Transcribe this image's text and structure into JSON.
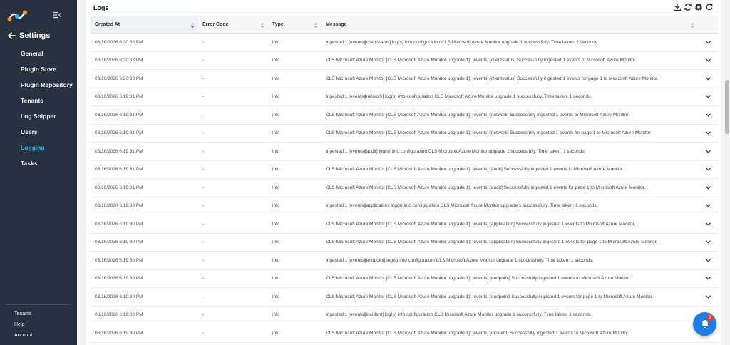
{
  "sidebar": {
    "settings_title": "Settings",
    "active_color": "#2bb6e9",
    "items": [
      {
        "label": "General"
      },
      {
        "label": "Plugin Store"
      },
      {
        "label": "Plugin Repository"
      },
      {
        "label": "Tenants"
      },
      {
        "label": "Log Shipper"
      },
      {
        "label": "Users"
      },
      {
        "label": "Logging",
        "active": true
      },
      {
        "label": "Tasks"
      }
    ],
    "bottom_links": [
      {
        "label": "Tenants"
      },
      {
        "label": "Help"
      },
      {
        "label": "Account"
      }
    ]
  },
  "panel": {
    "title": "Logs",
    "tool_icons": [
      "download-icon",
      "sync-icon",
      "settings-icon",
      "refresh-icon"
    ]
  },
  "table": {
    "columns": [
      {
        "label": "Created At",
        "sorted": true
      },
      {
        "label": "Error Code"
      },
      {
        "label": "Type"
      },
      {
        "label": "Message"
      }
    ],
    "rows": [
      {
        "created_at": "03/16/2026 6:20:33 PM",
        "error_code": "-",
        "type": "info",
        "message": "Ingested 1 [events][clientstatus] log(s) into configuration CLS Microsoft Azure Monitor upgrade 1 successfully. Time taken: 2 seconds."
      },
      {
        "created_at": "03/16/2026 6:20:33 PM",
        "error_code": "-",
        "type": "info",
        "message": "CLS Microsoft Azure Monitor [CLS Microsoft Azure Monitor upgrade 1]: [events]:[clientstatus] Successfully ingested 1 events to Microsoft Azure Monitor."
      },
      {
        "created_at": "03/16/2026 6:20:33 PM",
        "error_code": "-",
        "type": "info",
        "message": "CLS Microsoft Azure Monitor [CLS Microsoft Azure Monitor upgrade 1]: [events]:[clientstatus] Successfully ingested 1 events for page 1 to Microsoft Azure Monitor."
      },
      {
        "created_at": "03/16/2026 6:19:31 PM",
        "error_code": "-",
        "type": "info",
        "message": "Ingested 1 [events][network] log(s) into configuration CLS Microsoft Azure Monitor upgrade 1 successfully. Time taken: 1 seconds."
      },
      {
        "created_at": "03/16/2026 6:19:31 PM",
        "error_code": "-",
        "type": "info",
        "message": "CLS Microsoft Azure Monitor [CLS Microsoft Azure Monitor upgrade 1]: [events]:[network] Successfully ingested 1 events to Microsoft Azure Monitor."
      },
      {
        "created_at": "03/16/2026 6:19:31 PM",
        "error_code": "-",
        "type": "info",
        "message": "CLS Microsoft Azure Monitor [CLS Microsoft Azure Monitor upgrade 1]: [events]:[network] Successfully ingested 1 events for page 1 to Microsoft Azure Monitor."
      },
      {
        "created_at": "03/16/2026 6:19:31 PM",
        "error_code": "-",
        "type": "info",
        "message": "Ingested 1 [events][audit] log(s) into configuration CLS Microsoft Azure Monitor upgrade 1 successfully. Time taken: 1 seconds."
      },
      {
        "created_at": "03/16/2026 6:19:31 PM",
        "error_code": "-",
        "type": "info",
        "message": "CLS Microsoft Azure Monitor [CLS Microsoft Azure Monitor upgrade 1]: [events]:[audit] Successfully ingested 1 events to Microsoft Azure Monitor."
      },
      {
        "created_at": "03/16/2026 6:19:31 PM",
        "error_code": "-",
        "type": "info",
        "message": "CLS Microsoft Azure Monitor [CLS Microsoft Azure Monitor upgrade 1]: [events]:[audit] Successfully ingested 1 events for page 1 to Microsoft Azure Monitor."
      },
      {
        "created_at": "03/16/2026 6:19:30 PM",
        "error_code": "-",
        "type": "info",
        "message": "Ingested 1 [events][application] log(s) into configuration CLS Microsoft Azure Monitor upgrade 1 successfully. Time taken: 1 seconds."
      },
      {
        "created_at": "03/16/2026 6:19:30 PM",
        "error_code": "-",
        "type": "info",
        "message": "CLS Microsoft Azure Monitor [CLS Microsoft Azure Monitor upgrade 1]: [events]:[application] Successfully ingested 1 events to Microsoft Azure Monitor."
      },
      {
        "created_at": "03/16/2026 6:19:30 PM",
        "error_code": "-",
        "type": "info",
        "message": "CLS Microsoft Azure Monitor [CLS Microsoft Azure Monitor upgrade 1]: [events]:[application] Successfully ingested 1 events for page 1 to Microsoft Azure Monitor."
      },
      {
        "created_at": "03/16/2026 6:19:30 PM",
        "error_code": "-",
        "type": "info",
        "message": "Ingested 1 [events][endpoint] log(s) into configuration CLS Microsoft Azure Monitor upgrade 1 successfully. Time taken: 1 seconds."
      },
      {
        "created_at": "03/16/2026 6:19:30 PM",
        "error_code": "-",
        "type": "info",
        "message": "CLS Microsoft Azure Monitor [CLS Microsoft Azure Monitor upgrade 1]: [events]:[endpoint] Successfully ingested 1 events to Microsoft Azure Monitor."
      },
      {
        "created_at": "03/16/2026 6:19:30 PM",
        "error_code": "-",
        "type": "info",
        "message": "CLS Microsoft Azure Monitor [CLS Microsoft Azure Monitor upgrade 1]: [events]:[endpoint] Successfully ingested 1 events for page 1 to Microsoft Azure Monitor."
      },
      {
        "created_at": "03/16/2026 6:19:30 PM",
        "error_code": "-",
        "type": "info",
        "message": "Ingested 1 [events][incident] log(s) into configuration CLS Microsoft Azure Monitor upgrade 1 successfully. Time taken: 1 seconds."
      },
      {
        "created_at": "03/16/2026 6:19:30 PM",
        "error_code": "-",
        "type": "info",
        "message": "CLS Microsoft Azure Monitor [CLS Microsoft Azure Monitor upgrade 1]: [events]:[incident] Successfully ingested 1 events to Microsoft Azure Monitor."
      }
    ]
  },
  "notifications": {
    "badge_count": "1",
    "fab_color": "#1d7de2",
    "badge_color": "#e53935"
  }
}
